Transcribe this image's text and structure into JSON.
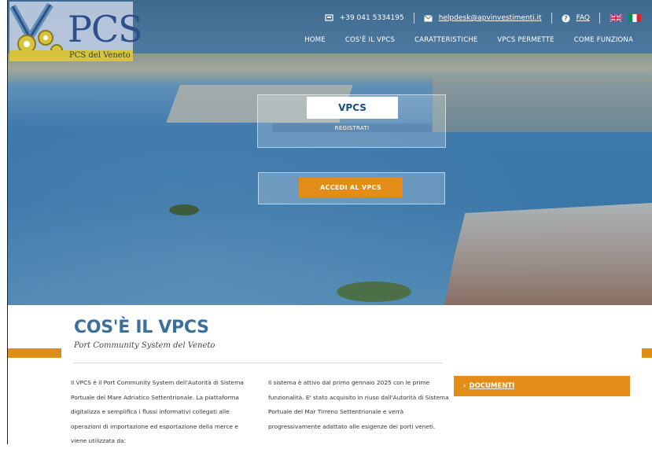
{
  "logo": {
    "name": "PCS",
    "subtitle": "PCS del Veneto"
  },
  "topbar": {
    "phone": "+39 041 5334195",
    "email": "helpdesk@apvinvestimenti.it",
    "faq": "FAQ"
  },
  "nav": [
    "HOME",
    "COS'È IL VPCS",
    "CARATTERISTICHE",
    "VPCS PERMETTE",
    "COME FUNZIONA"
  ],
  "hero": {
    "box_title": "VPCS",
    "register_label": "REGISTRATI",
    "login_label": "ACCEDI AL VPCS"
  },
  "content": {
    "title": "COS'È IL VPCS",
    "subtitle": "Port Community System del Veneto",
    "col1": "Il VPCS è il Port Community System dell'Autorità di Sistema Portuale del Mare Adriatico Settentrionale. La piattaforma digitalizza e semplifica i flussi informativi collegati alle operazioni di importazione ed esportazione della merce e viene utilizzata da:",
    "col2": "Il sistema è attivo dal primo gennaio 2025 con le prime funzionalità. E' stato acquisito in riuso dall'Autorità di Sistema Portuale del Mar Tirreno Settentrionale e verrà progressivamente adattato alle esigenze dei porti veneti.",
    "documents_arrow": "›",
    "documents_label": "DOCUMENTI"
  },
  "colors": {
    "accent": "#e48c18",
    "brand": "#3d6f9c"
  }
}
